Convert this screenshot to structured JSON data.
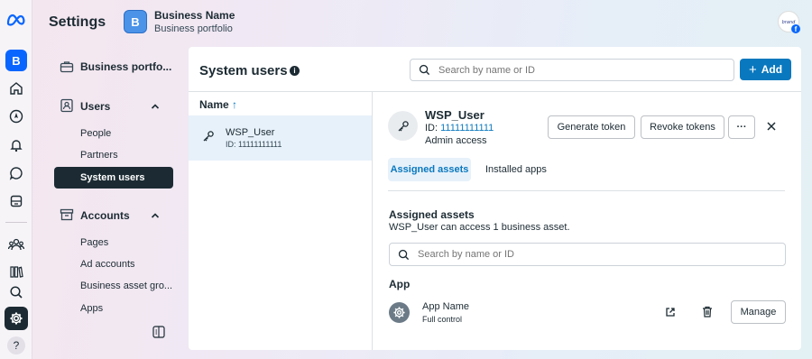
{
  "colors": {
    "accent": "#0a78be",
    "brand": "#0866ff",
    "sidebar_active": "#1c2b33",
    "selected_row": "#e7f1fa"
  },
  "header": {
    "title": "Settings",
    "portfolio_badge": "B",
    "portfolio_name": "Business Name",
    "portfolio_sub": "Business portfolio",
    "avatar_text": "brand"
  },
  "rail": {
    "items": [
      {
        "name": "meta-logo-icon"
      },
      {
        "name": "business-badge",
        "label": "B"
      },
      {
        "name": "home-icon"
      },
      {
        "name": "compass-icon"
      },
      {
        "name": "bell-icon"
      },
      {
        "name": "chat-bubble-icon"
      },
      {
        "name": "pages-icon"
      },
      {
        "name": "people-group-icon"
      },
      {
        "name": "library-icon"
      },
      {
        "name": "search-icon"
      },
      {
        "name": "gear-icon"
      },
      {
        "name": "help-icon",
        "label": "?"
      }
    ]
  },
  "sidebar": {
    "top_item": "Business portfo...",
    "users_section": "Users",
    "users_items": [
      "People",
      "Partners",
      "System users"
    ],
    "accounts_section": "Accounts",
    "accounts_items": [
      "Pages",
      "Ad accounts",
      "Business asset gro...",
      "Apps"
    ]
  },
  "main": {
    "title": "System users",
    "info_glyph": "i",
    "search_placeholder": "Search by name or ID",
    "add_label": "Add",
    "column_name": "Name",
    "sort_glyph": "↑",
    "rows": [
      {
        "name": "WSP_User",
        "id": "ID: 11111111111"
      }
    ]
  },
  "detail": {
    "name": "WSP_User",
    "id_prefix": "ID: ",
    "id_value": "11111111111",
    "access": "Admin access",
    "generate_token": "Generate token",
    "revoke_tokens": "Revoke tokens",
    "more": "···",
    "tabs": [
      "Assigned assets",
      "Installed apps"
    ],
    "section_title": "Assigned assets",
    "section_sub": "WSP_User can access 1 business asset.",
    "search_placeholder": "Search by name or ID",
    "app_heading": "App",
    "app_name": "App Name",
    "app_control": "Full control",
    "manage_label": "Manage"
  }
}
